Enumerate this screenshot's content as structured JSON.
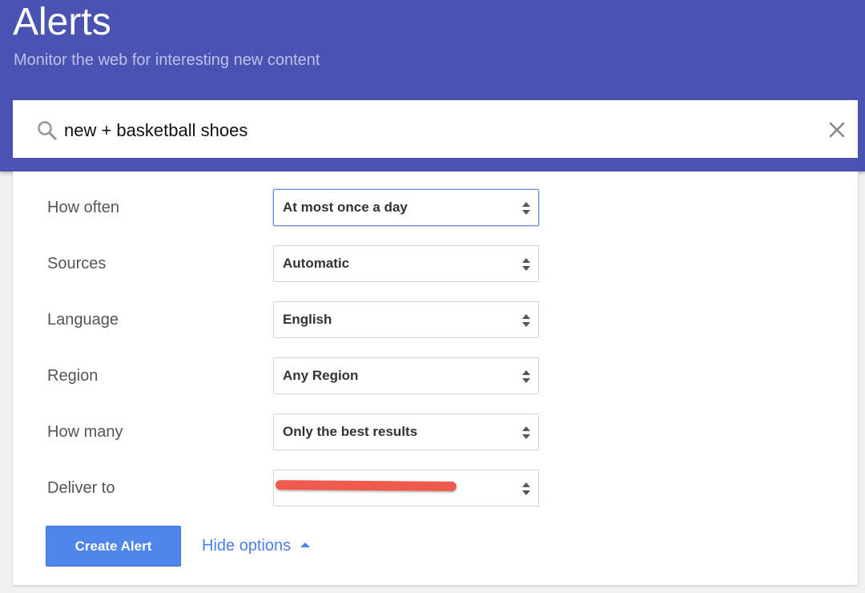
{
  "app": {
    "title": "Alerts",
    "subtitle": "Monitor the web for interesting new content"
  },
  "search": {
    "value": "new + basketball shoes",
    "icon": "search-icon",
    "clear_icon": "close-icon"
  },
  "options": [
    {
      "label": "How often",
      "value": "At most once a day"
    },
    {
      "label": "Sources",
      "value": "Automatic"
    },
    {
      "label": "Language",
      "value": "English"
    },
    {
      "label": "Region",
      "value": "Any Region"
    },
    {
      "label": "How many",
      "value": "Only the best results"
    },
    {
      "label": "Deliver to",
      "value": ""
    }
  ],
  "actions": {
    "create_label": "Create Alert",
    "hide_options_label": "Hide options"
  },
  "colors": {
    "header_bg": "#4a53b1",
    "primary_button": "#4f86ec",
    "link": "#4a80e8",
    "redaction": "#ee5a4c"
  }
}
